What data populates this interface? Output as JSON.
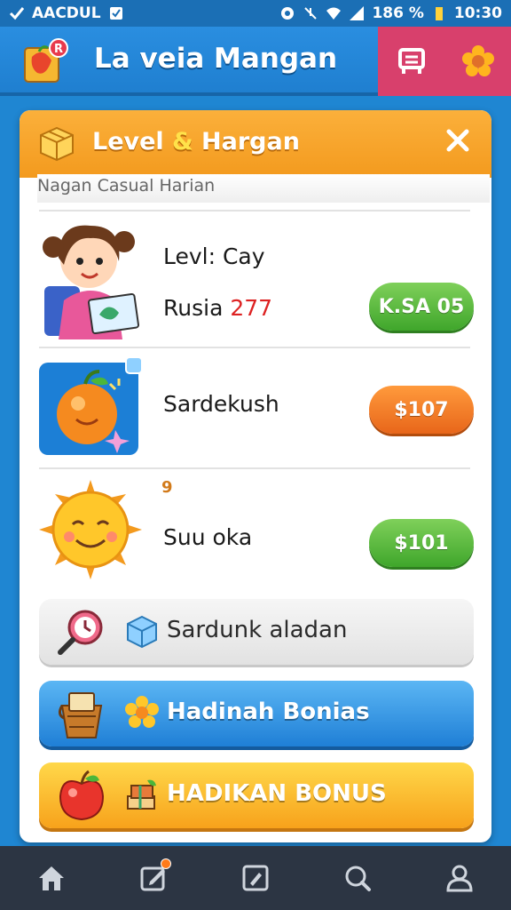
{
  "status_bar": {
    "carrier": "AACDUL",
    "battery": "186 %",
    "time": "10:30"
  },
  "app": {
    "title": "La veia Mangan"
  },
  "panel": {
    "title_part1": "Level ",
    "title_amp": "&",
    "title_part2": " Hargan",
    "subtitle": "Nagan Casual Harian"
  },
  "rows": [
    {
      "label": "Levl: Cay",
      "sub_text": "Rusia ",
      "sub_number": "277",
      "price": "K.SA 05"
    },
    {
      "label": "Sardekush",
      "price": "$107"
    },
    {
      "label": "Suu oka",
      "badge": "9",
      "price": "$101"
    }
  ],
  "buttons": {
    "grey_label": "Sardunk aladan",
    "blue_label": "Hadinah Bonias",
    "yellow_label": "HADIKAN BONUS"
  },
  "colors": {
    "primary_blue": "#1f86d2",
    "header_orange": "#f39a1e",
    "action_pink": "#d8406c",
    "nav_dark": "#2c3543"
  }
}
